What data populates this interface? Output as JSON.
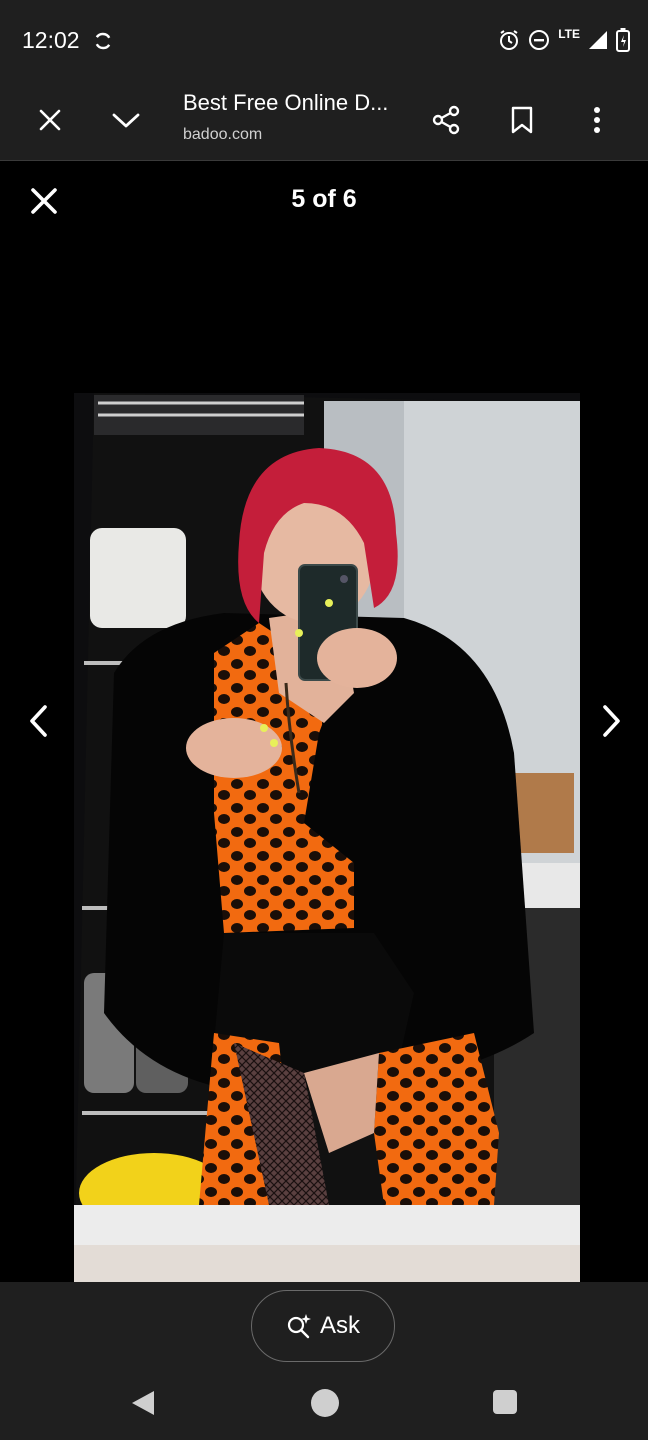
{
  "status_bar": {
    "time": "12:02",
    "network": "LTE"
  },
  "toolbar": {
    "page_title": "Best Free Online D...",
    "url": "badoo.com"
  },
  "viewer": {
    "counter": "5 of 6"
  },
  "bottom": {
    "ask_label": "Ask"
  },
  "icons": {
    "close": "close-icon",
    "chevron": "chevron-down-icon",
    "share": "share-icon",
    "bookmark": "bookmark-icon",
    "more": "more-vert-icon",
    "prev": "chevron-left-icon",
    "next": "chevron-right-icon",
    "ask": "ask-sparkle-icon"
  },
  "colors": {
    "chrome_bg": "#1f1f1f",
    "viewer_bg": "#000000",
    "hair": "#c41e3a",
    "orange_print": "#f26a10"
  }
}
